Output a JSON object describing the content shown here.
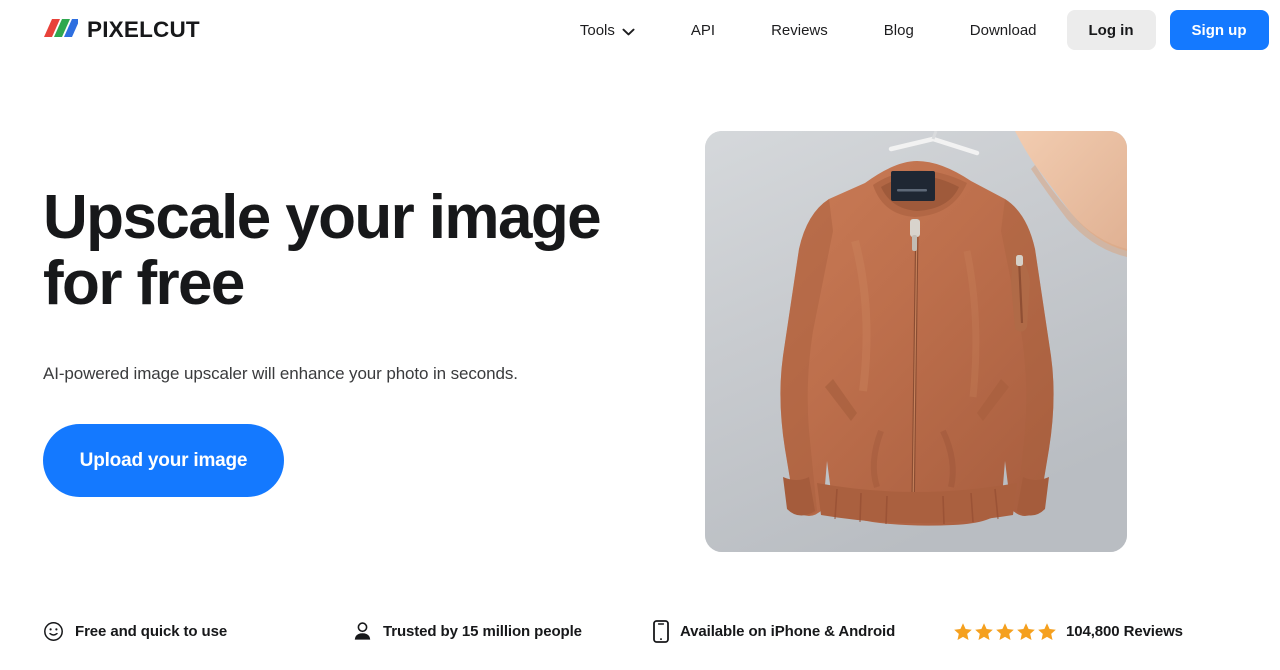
{
  "brand": {
    "name": "PIXELCUT",
    "logo_icon": "triple-slash-logo",
    "slash_colors": [
      "#e8423a",
      "#2fa84f",
      "#2e6fe0"
    ]
  },
  "nav": {
    "items": [
      {
        "label": "Tools",
        "icon": "chevron-down-icon",
        "has_dropdown": true
      },
      {
        "label": "API",
        "has_dropdown": false
      },
      {
        "label": "Reviews",
        "has_dropdown": false
      },
      {
        "label": "Blog",
        "has_dropdown": false
      },
      {
        "label": "Download",
        "has_dropdown": false
      }
    ],
    "login_label": "Log in",
    "signup_label": "Sign up"
  },
  "hero": {
    "title_line1": "Upscale your image",
    "title_line2": "for free",
    "subtitle": "AI-powered image upscaler will enhance your photo in seconds.",
    "cta_label": "Upload your image",
    "image_alt": "Terracotta bomber jacket on a hanger held by a hand against a gray backdrop"
  },
  "features": [
    {
      "icon": "smiley-face-icon",
      "label": "Free and quick to use"
    },
    {
      "icon": "person-icon",
      "label": "Trusted by 15 million people"
    },
    {
      "icon": "mobile-phone-icon",
      "label": "Available on iPhone & Android"
    },
    {
      "icon": "star-rating-icon",
      "label": "104,800 Reviews",
      "stars": 5,
      "star_color": "#f5a01e"
    }
  ],
  "colors": {
    "accent_blue": "#1479ff",
    "login_bg": "#ececec",
    "star_orange": "#f5a01e",
    "text_primary": "#17181a",
    "page_bg": "#ffffff"
  }
}
